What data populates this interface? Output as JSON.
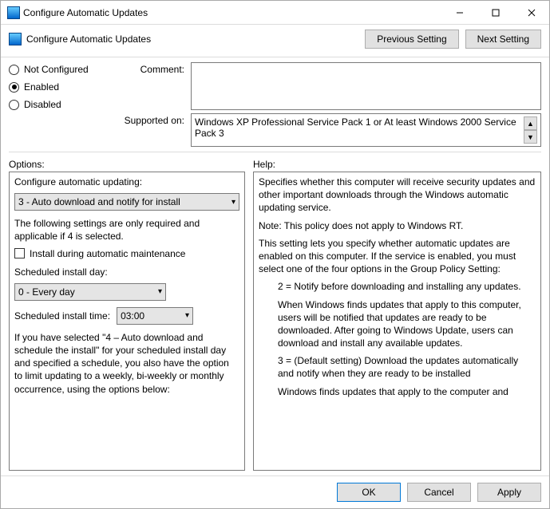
{
  "window": {
    "title": "Configure Automatic Updates"
  },
  "subheader": {
    "title": "Configure Automatic Updates",
    "prev": "Previous Setting",
    "next": "Next Setting"
  },
  "state": {
    "not_configured": "Not Configured",
    "enabled": "Enabled",
    "disabled": "Disabled",
    "selected": "enabled"
  },
  "fields": {
    "comment_label": "Comment:",
    "comment_value": "",
    "supported_label": "Supported on:",
    "supported_value": "Windows XP Professional Service Pack 1 or At least Windows 2000 Service Pack 3"
  },
  "labels": {
    "options": "Options:",
    "help": "Help:"
  },
  "options": {
    "configure_label": "Configure automatic updating:",
    "configure_value": "3 - Auto download and notify for install",
    "note": "The following settings are only required and applicable if 4 is selected.",
    "install_maint_label": "Install during automatic maintenance",
    "sched_day_label": "Scheduled install day:",
    "sched_day_value": "0 - Every day",
    "sched_time_label": "Scheduled install time:",
    "sched_time_value": "03:00",
    "footnote": "If you have selected \"4 – Auto download and schedule the install\" for your scheduled install day and specified a schedule, you also have the option to limit updating to a weekly, bi-weekly or monthly occurrence, using the options below:"
  },
  "help": {
    "p1": "Specifies whether this computer will receive security updates and other important downloads through the Windows automatic updating service.",
    "p2": "Note: This policy does not apply to Windows RT.",
    "p3": "This setting lets you specify whether automatic updates are enabled on this computer. If the service is enabled, you must select one of the four options in the Group Policy Setting:",
    "p4": "2 = Notify before downloading and installing any updates.",
    "p5": "When Windows finds updates that apply to this computer, users will be notified that updates are ready to be downloaded. After going to Windows Update, users can download and install any available updates.",
    "p6": "3 = (Default setting) Download the updates automatically and notify when they are ready to be installed",
    "p7": "Windows finds updates that apply to the computer and"
  },
  "footer": {
    "ok": "OK",
    "cancel": "Cancel",
    "apply": "Apply"
  }
}
